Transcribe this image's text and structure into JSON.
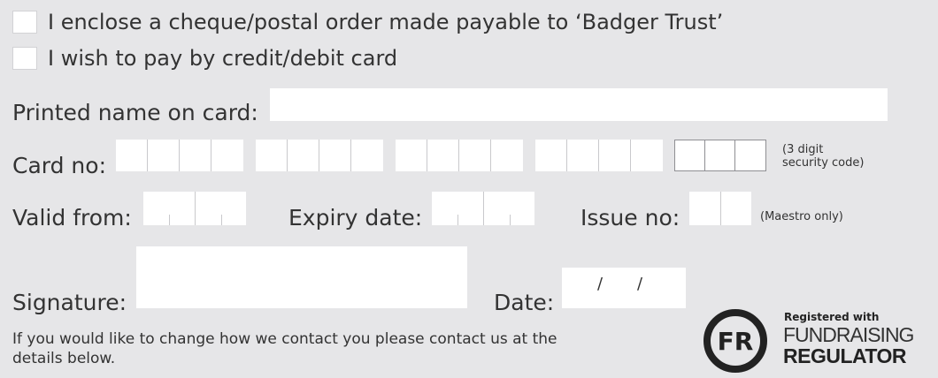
{
  "payment_options": {
    "cheque_label": "I enclose a cheque/postal order made payable to ‘Badger Trust’",
    "card_label": "I wish to pay by credit/debit card"
  },
  "form": {
    "name_label": "Printed name on card:",
    "card_no_label": "Card no:",
    "security_code_note_line1": "(3 digit",
    "security_code_note_line2": "security code)",
    "valid_from_label": "Valid from:",
    "expiry_label": "Expiry date:",
    "issue_label": "Issue no:",
    "maestro_note": "(Maestro only)",
    "signature_label": "Signature:",
    "date_label": "Date:",
    "date_separator": "/"
  },
  "footer": {
    "contact_note": "If you would like to change how we contact you please contact us at the details below."
  },
  "fr_badge": {
    "mark": "FR",
    "registered": "Registered with",
    "line1": "FUNDRAISING",
    "line2": "REGULATOR"
  }
}
